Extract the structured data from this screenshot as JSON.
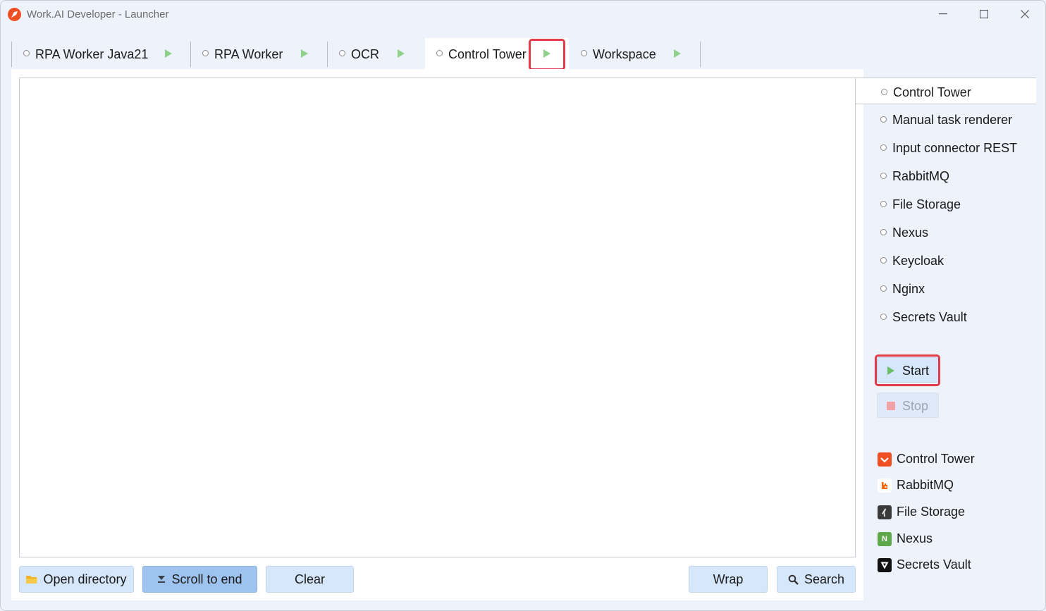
{
  "window": {
    "title": "Work.AI Developer - Launcher"
  },
  "tabs": [
    {
      "label": "RPA Worker Java21"
    },
    {
      "label": "RPA Worker"
    },
    {
      "label": "OCR"
    },
    {
      "label": "Control Tower",
      "active": true
    },
    {
      "label": "Workspace"
    }
  ],
  "services": [
    {
      "label": "Control Tower",
      "selected": true
    },
    {
      "label": "Manual task renderer"
    },
    {
      "label": "Input connector REST"
    },
    {
      "label": "RabbitMQ"
    },
    {
      "label": "File Storage"
    },
    {
      "label": "Nexus"
    },
    {
      "label": "Keycloak"
    },
    {
      "label": "Nginx"
    },
    {
      "label": "Secrets Vault"
    }
  ],
  "controls": {
    "start_label": "Start",
    "stop_label": "Stop"
  },
  "links": [
    {
      "label": "Control Tower",
      "icon": "control-tower-icon",
      "color": "#f04e23"
    },
    {
      "label": "RabbitMQ",
      "icon": "rabbitmq-icon",
      "color": "#ff6600"
    },
    {
      "label": "File Storage",
      "icon": "file-storage-icon",
      "color": "#3a3a3a"
    },
    {
      "label": "Nexus",
      "icon": "nexus-icon",
      "color": "#5fa84a"
    },
    {
      "label": "Secrets Vault",
      "icon": "vault-icon",
      "color": "#111111"
    }
  ],
  "toolbar": {
    "open_directory": "Open directory",
    "scroll_to_end": "Scroll to end",
    "clear": "Clear",
    "wrap": "Wrap",
    "search": "Search"
  },
  "colors": {
    "accent": "#e23b4a",
    "button": "#d6e6fb",
    "pressed": "#9ec3ee",
    "play": "#8fd18a"
  }
}
